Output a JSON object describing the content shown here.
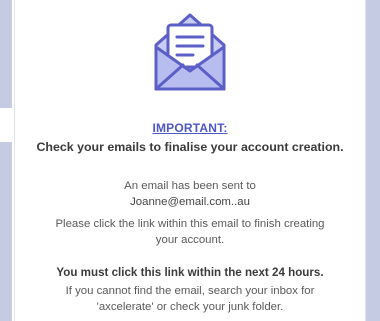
{
  "notice": {
    "heading": "IMPORTANT:",
    "subheading": "Check your emails to finalise your account creation.",
    "sent_line": "An email has been sent to",
    "email": "Joanne@email.com..au",
    "instruction_line1": "Please click the link within this email to finish creating",
    "instruction_line2": "your account.",
    "deadline": "You must click this link within the next 24 hours.",
    "help_line1": "If you cannot find the email, search your inbox for",
    "help_line2": "'axcelerate' or check your junk folder."
  },
  "colors": {
    "accent": "#4e57c6",
    "envelope_stroke": "#5b5fc7",
    "envelope_fill": "#b8bdf0",
    "letter_fill": "#ffffff",
    "side_panel": "#c5cbe2"
  },
  "icons": {
    "envelope": "open-envelope-icon"
  }
}
